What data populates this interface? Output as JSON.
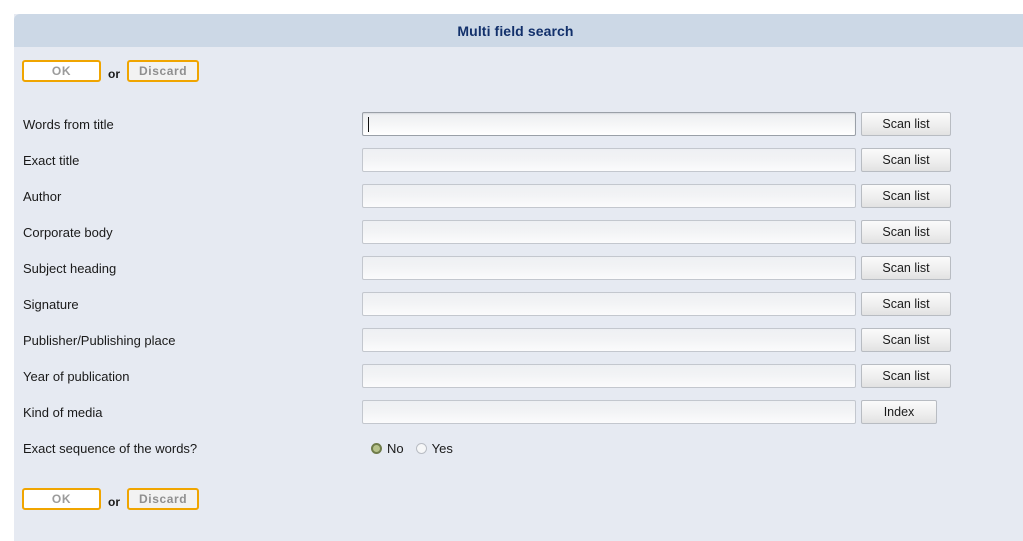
{
  "header": {
    "title": "Multi field search"
  },
  "actions": {
    "ok_label": "OK",
    "or_label": "or",
    "discard_label": "Discard"
  },
  "form": {
    "rows": [
      {
        "label": "Words from title",
        "value": "",
        "placeholder": "",
        "focused": true,
        "button": "Scan list",
        "button_kind": "scan"
      },
      {
        "label": "Exact title",
        "value": "",
        "placeholder": "",
        "focused": false,
        "button": "Scan list",
        "button_kind": "scan"
      },
      {
        "label": "Author",
        "value": "",
        "placeholder": "",
        "focused": false,
        "button": "Scan list",
        "button_kind": "scan"
      },
      {
        "label": "Corporate body",
        "value": "",
        "placeholder": "",
        "focused": false,
        "button": "Scan list",
        "button_kind": "scan"
      },
      {
        "label": "Subject heading",
        "value": "",
        "placeholder": "",
        "focused": false,
        "button": "Scan list",
        "button_kind": "scan"
      },
      {
        "label": "Signature",
        "value": "",
        "placeholder": "",
        "focused": false,
        "button": "Scan list",
        "button_kind": "scan"
      },
      {
        "label": "Publisher/Publishing place",
        "value": "",
        "placeholder": "",
        "focused": false,
        "button": "Scan list",
        "button_kind": "scan"
      },
      {
        "label": "Year of publication",
        "value": "",
        "placeholder": "",
        "focused": false,
        "button": "Scan list",
        "button_kind": "scan"
      },
      {
        "label": "Kind of media",
        "value": "",
        "placeholder": "",
        "focused": false,
        "button": "Index",
        "button_kind": "index"
      }
    ],
    "radio_row": {
      "label": "Exact sequence of the words?",
      "options": [
        {
          "label": "No",
          "selected": true
        },
        {
          "label": "Yes",
          "selected": false
        }
      ]
    }
  },
  "colors": {
    "header_bar": "#ccd8e6",
    "header_title": "#12306b",
    "page_background": "#e6eaf2",
    "gold_border": "#f0a500",
    "radio_selected": "#6f7c4a"
  }
}
